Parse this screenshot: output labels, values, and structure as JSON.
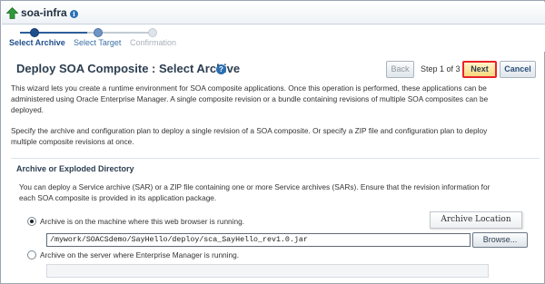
{
  "header": {
    "app_name": "soa-infra",
    "info_glyph": "i",
    "up_icon": "green-up-arrow-icon"
  },
  "train": {
    "steps": [
      {
        "label": "Select Archive",
        "state": "active"
      },
      {
        "label": "Select Target",
        "state": "visited"
      },
      {
        "label": "Confirmation",
        "state": "disabled"
      }
    ]
  },
  "page": {
    "title": "Deploy SOA Composite : Select Archive",
    "help_glyph": "?"
  },
  "toolbar": {
    "back_label": "Back",
    "step_text": "Step 1 of 3",
    "next_label": "Next",
    "cancel_label": "Cancel"
  },
  "intro": {
    "paragraph1_line1": "This wizard lets you create a runtime environment for SOA composite applications. Once this operation is performed, these applications can be",
    "paragraph1_line2": "administered using Oracle Enterprise Manager. A single composite revision or a bundle containing revisions of multiple SOA composites can be",
    "paragraph1_line3": "deployed.",
    "paragraph2_line1": "Specify the archive and configuration plan to deploy a single revision of a SOA composite. Or specify a ZIP file and configuration plan to deploy",
    "paragraph2_line2": "multiple composite revisions at once."
  },
  "archive_section": {
    "title": "Archive or Exploded Directory",
    "description_line1": "You can deploy a Service archive (SAR) or a ZIP file containing one or more Service archives (SARs). Ensure that the revision information for",
    "description_line2": "each SOA composite is provided in its application package.",
    "option_local_label": "Archive is on the machine where this web browser is running.",
    "option_local_checked": true,
    "path_value": "/mywork/SOACSdemo/SayHello/deploy/sca_SayHello_rev1.0.jar",
    "browse_label": "Browse...",
    "tooltip": "Archive Location",
    "option_server_label": "Archive on the server where Enterprise Manager is running.",
    "option_server_checked": false,
    "server_path_value": ""
  },
  "colors": {
    "train_active": "#1f4e8c",
    "next_highlight": "#e8232a",
    "next_fill": "#f7d97e"
  }
}
